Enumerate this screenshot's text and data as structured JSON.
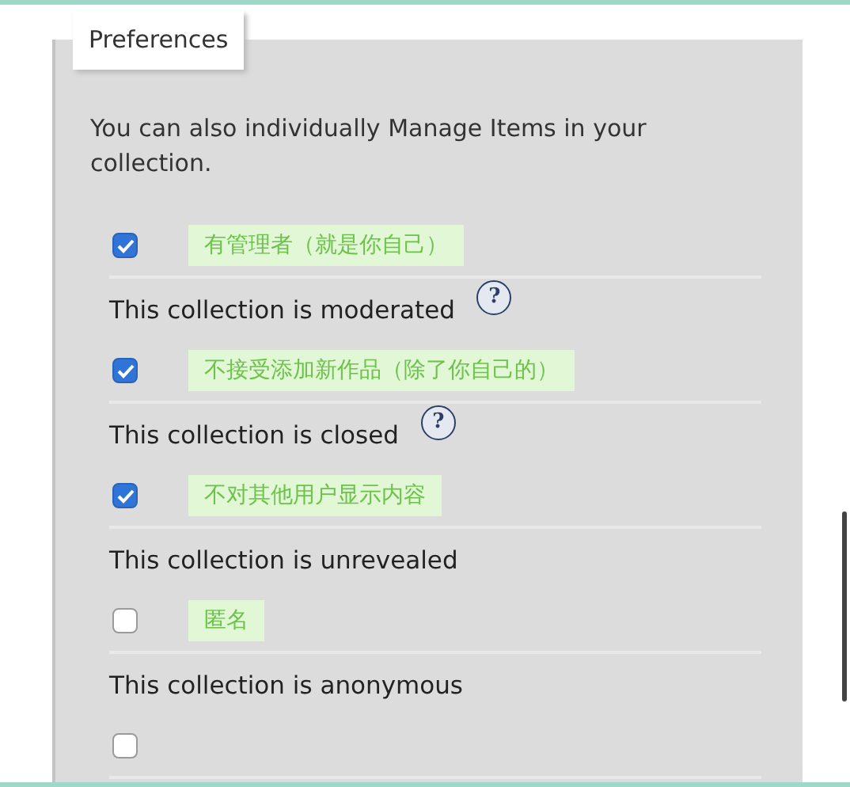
{
  "tab": {
    "label": "Preferences"
  },
  "intro": "You can also individually Manage Items in your collection.",
  "options": [
    {
      "checked": true,
      "annotation": "有管理者（就是你自己）",
      "label": "This collection is moderated",
      "help": "?"
    },
    {
      "checked": true,
      "annotation": "不接受添加新作品（除了你自己的）",
      "label": "This collection is closed",
      "help": "?"
    },
    {
      "checked": true,
      "annotation": "不对其他用户显示内容",
      "label": "This collection is unrevealed"
    },
    {
      "checked": false,
      "annotation": "匿名",
      "label": "This collection is anonymous"
    },
    {
      "checked": false
    }
  ]
}
